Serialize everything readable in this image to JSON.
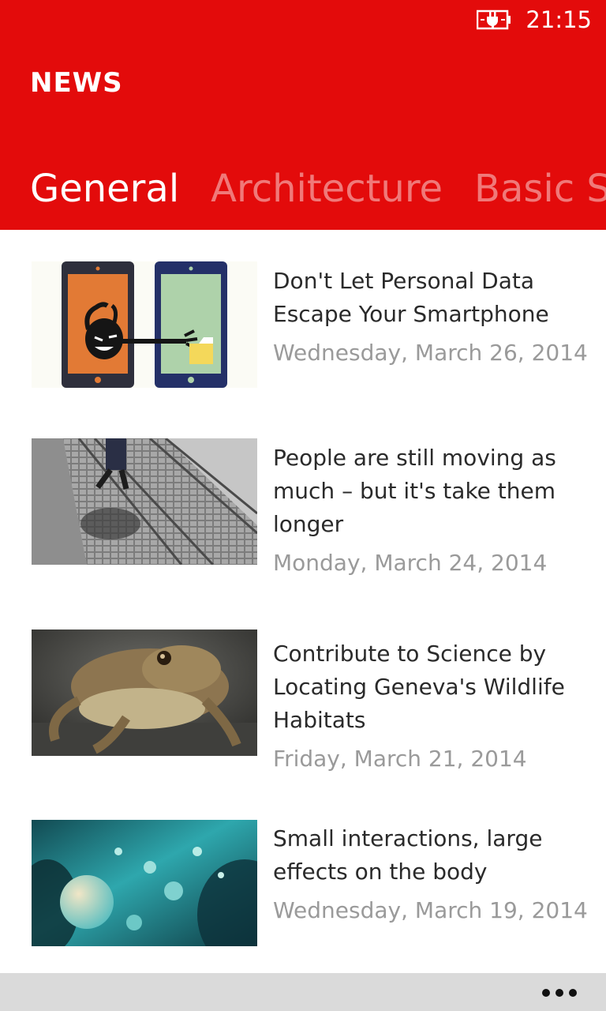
{
  "status": {
    "time": "21:15",
    "battery_icon": "battery-charging-icon"
  },
  "app": {
    "title": "NEWS",
    "accent": "#e30b0b"
  },
  "pivots": [
    {
      "label": "General"
    },
    {
      "label": "Architecture"
    },
    {
      "label": "Basic Scie"
    }
  ],
  "articles": [
    {
      "title": "Don't Let Personal Data Escape Your Smartphone",
      "date": "Wednesday, March 26, 2014"
    },
    {
      "title": "People are still moving as much – but it's take them longer",
      "date": "Monday, March 24, 2014"
    },
    {
      "title": "Contribute to Science by Locating Geneva's Wildlife Habitats",
      "date": "Friday, March 21, 2014"
    },
    {
      "title": "Small interactions, large effects on the body",
      "date": "Wednesday, March 19, 2014"
    }
  ],
  "appbar": {
    "more_icon": "more-ellipsis-icon"
  }
}
